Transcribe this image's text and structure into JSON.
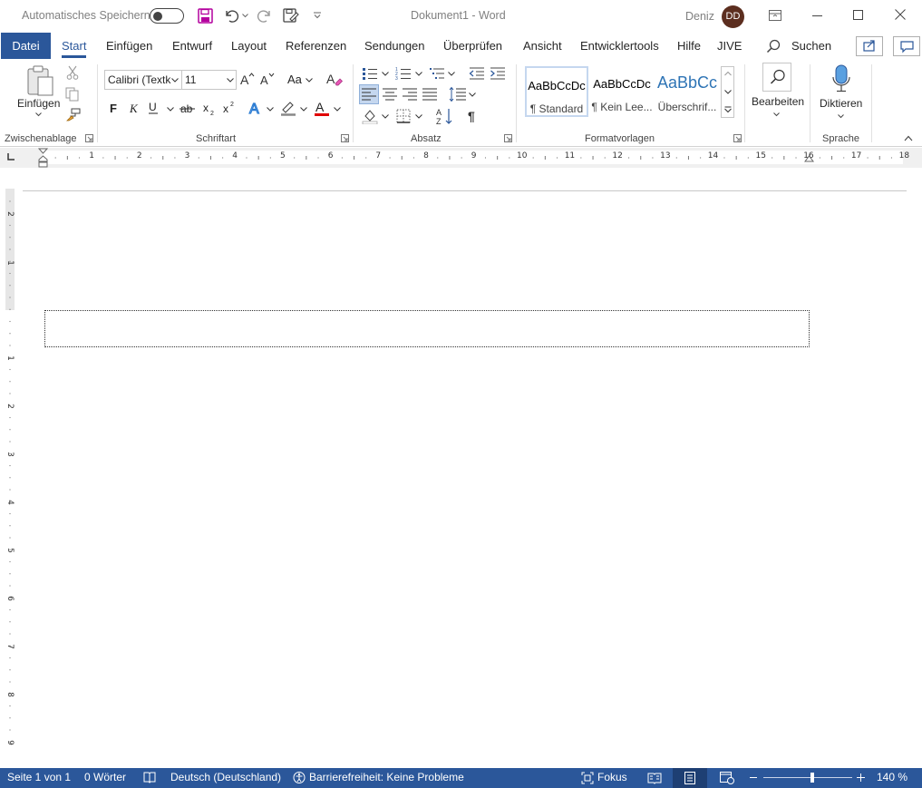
{
  "titlebar": {
    "autosave_label": "Automatisches Speichern",
    "doc_title": "Dokument1  -  Word",
    "user_name": "Deniz",
    "user_initials": "DD"
  },
  "tabs": [
    {
      "label": "Datei"
    },
    {
      "label": "Start"
    },
    {
      "label": "Einfügen"
    },
    {
      "label": "Entwurf"
    },
    {
      "label": "Layout"
    },
    {
      "label": "Referenzen"
    },
    {
      "label": "Sendungen"
    },
    {
      "label": "Überprüfen"
    },
    {
      "label": "Ansicht"
    },
    {
      "label": "Entwicklertools"
    },
    {
      "label": "Hilfe"
    },
    {
      "label": "JIVE"
    }
  ],
  "search_label": "Suchen",
  "ribbon": {
    "clipboard": {
      "paste_label": "Einfügen",
      "group_label": "Zwischenablage"
    },
    "font": {
      "font_name": "Calibri (Textk",
      "font_size": "11",
      "case_label": "Aa",
      "group_label": "Schriftart"
    },
    "paragraph": {
      "group_label": "Absatz"
    },
    "styles": {
      "group_label": "Formatvorlagen",
      "items": [
        {
          "sample": "AaBbCcDc",
          "name": "¶ Standard"
        },
        {
          "sample": "AaBbCcDc",
          "name": "¶ Kein Lee..."
        },
        {
          "sample": "AaBbCc",
          "name": "Überschrif..."
        }
      ]
    },
    "editing": {
      "label": "Bearbeiten"
    },
    "voice": {
      "label": "Diktieren",
      "group_label": "Sprache"
    }
  },
  "ruler": {
    "numbers": [
      "1",
      "2",
      "3",
      "4",
      "5",
      "6",
      "7",
      "8",
      "9",
      "10",
      "11",
      "12",
      "13",
      "14",
      "15",
      "16",
      "17",
      "18"
    ],
    "vertical_numbers": [
      "2",
      "1",
      "1",
      "2",
      "3",
      "4",
      "5",
      "6",
      "7",
      "8",
      "9"
    ]
  },
  "statusbar": {
    "page": "Seite 1 von 1",
    "words": "0 Wörter",
    "language": "Deutsch (Deutschland)",
    "accessibility": "Barrierefreiheit: Keine Probleme",
    "focus": "Fokus",
    "zoom": "140 %"
  },
  "colors": {
    "accent": "#2b579a",
    "avatar": "#5c2e1f",
    "font_color_bar": "#e00000",
    "save_icon": "#b4009e"
  }
}
